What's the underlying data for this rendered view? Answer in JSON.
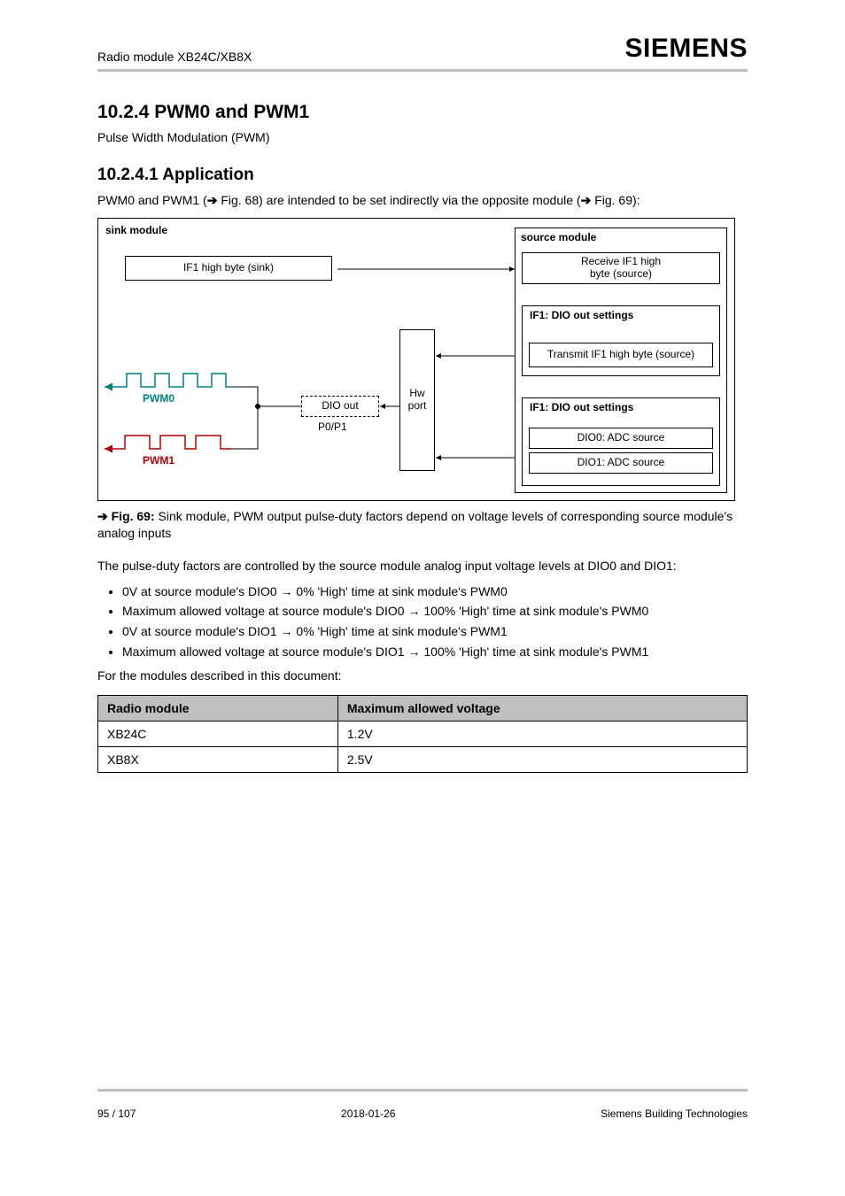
{
  "header": {
    "left": "Radio module XB24C/XB8X",
    "brand": "SIEMENS"
  },
  "section": {
    "title": "10.2.4 PWM0 and PWM1",
    "lede": "Pulse Width Modulation (PWM)",
    "h3": "10.2.4.1 Application",
    "p1_a": "PWM0 and PWM1 (",
    "p1_b": "Fig. 68) are intended to be set indirectly via the opposite module (",
    "p1_c": "Fig. 69):",
    "fig_caption_prefix": "Fig. 69:",
    "fig_caption": "Sink module, PWM output pulse-duty factors depend on voltage levels of corresponding source module's analog inputs",
    "p2": "The pulse-duty factors are controlled by the source module analog input voltage levels at DIO0 and DIO1:",
    "b1": "0V at source module's DIO0 → 0% 'High' time at sink module's PWM0",
    "b2": "Maximum allowed voltage at source module's DIO0 → 100% 'High' time at sink module's PWM0",
    "b3": "0V at source module's DIO1 → 0% 'High' time at sink module's PWM1",
    "b4": "Maximum allowed voltage at source module's DIO1 → 100% 'High' time at sink module's PWM1",
    "module_sentence": "For the modules described in this document:",
    "table": {
      "head1": "Radio module",
      "head2": "Maximum allowed voltage",
      "r1c1": "XB24C",
      "r1c2": "1.2V",
      "r2c1": "XB8X",
      "r2c2": "2.5V"
    }
  },
  "diagram": {
    "sink_label": "sink module",
    "if_line": "IF1 high byte (sink)",
    "rx_line1": "Receive IF1 high",
    "rx_line2": "byte (source)",
    "hwport": "Hw port",
    "dashed": "DIO out",
    "p0p1": "P0/P1",
    "source_label": "source module",
    "txif1": "Transmit IF1 high byte (source)",
    "dio_heading": "IF1: DIO out settings",
    "dio0": "DIO0: ADC source",
    "dio1": "DIO1: ADC source"
  },
  "waves": {
    "pwm0": "PWM0",
    "pwm1": "PWM1"
  },
  "footer": {
    "page_of": "95 / 107",
    "date": "2018-01-26",
    "company": "Siemens Building Technologies"
  }
}
